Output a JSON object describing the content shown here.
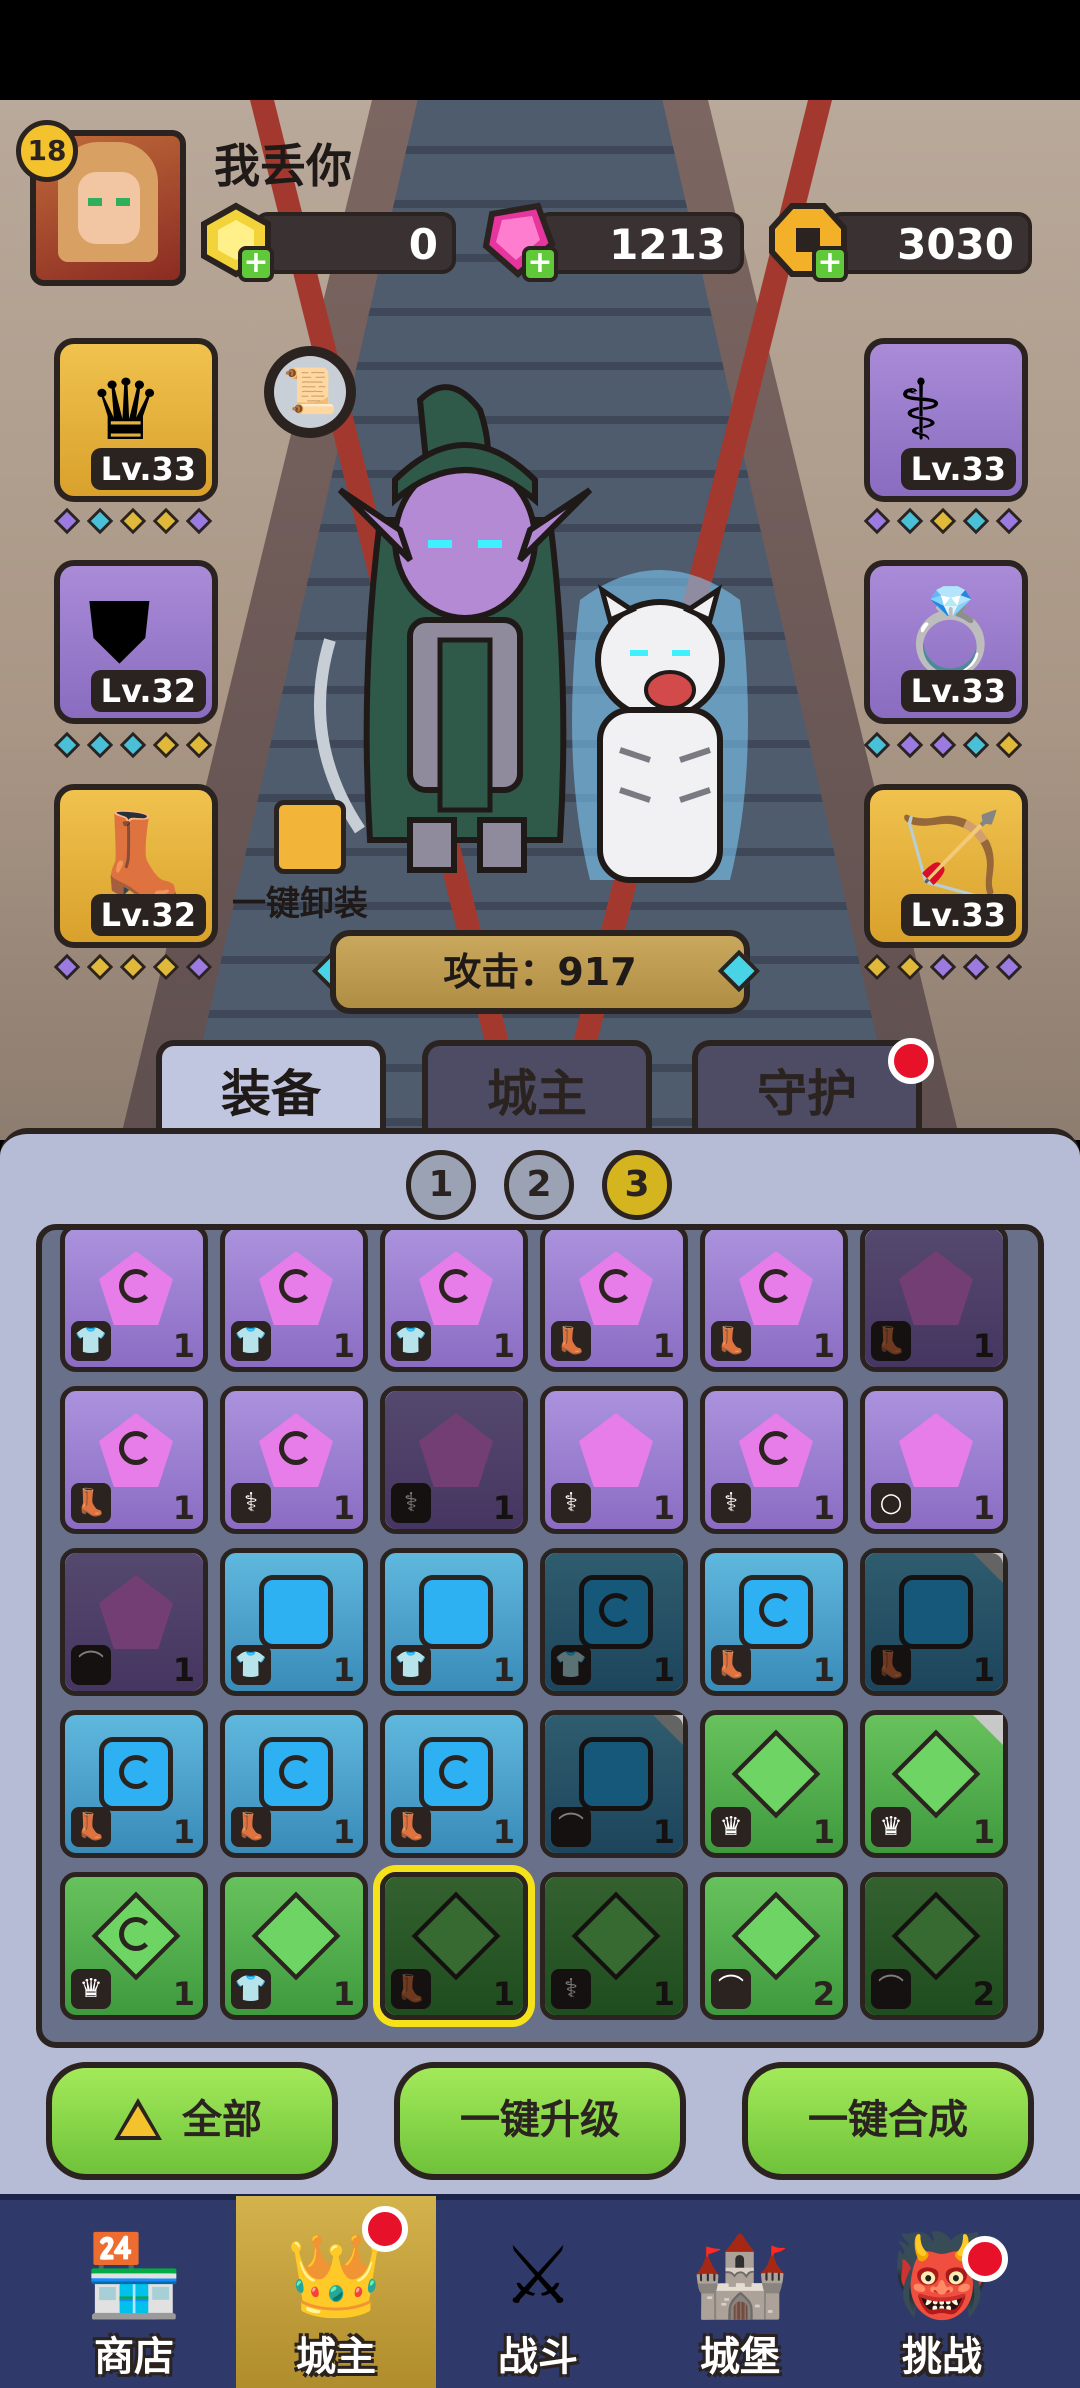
{
  "player": {
    "level": "18",
    "name": "我丢你"
  },
  "currencies": [
    {
      "name": "gold-ingot",
      "value": "0",
      "color": "#f2d43a"
    },
    {
      "name": "pink-gem",
      "value": "1213",
      "color": "#e6359c"
    },
    {
      "name": "coin",
      "value": "3030",
      "color": "#f3b12a"
    }
  ],
  "equipment_left": [
    {
      "name": "crown",
      "level": "Lv.33",
      "icon": "crown-icon",
      "gems": [
        "#9b7be0",
        "#49c0d8",
        "#e0b93a",
        "#e0b93a",
        "#9b7be0"
      ]
    },
    {
      "name": "armor",
      "level": "Lv.32",
      "icon": "armor-icon",
      "gems": [
        "#49c0d8",
        "#49c0d8",
        "#49c0d8",
        "#e0b93a",
        "#e0b93a"
      ]
    },
    {
      "name": "boots",
      "level": "Lv.32",
      "icon": "boot-icon",
      "gems": [
        "#9b7be0",
        "#e0b93a",
        "#e0b93a",
        "#e0b93a",
        "#9b7be0"
      ]
    }
  ],
  "equipment_right": [
    {
      "name": "staff",
      "level": "Lv.33",
      "icon": "staff-icon",
      "gems": [
        "#9b7be0",
        "#49c0d8",
        "#e0b93a",
        "#49c0d8",
        "#9b7be0"
      ]
    },
    {
      "name": "ring",
      "level": "Lv.33",
      "icon": "ring-icon",
      "gems": [
        "#49c0d8",
        "#9b7be0",
        "#9b7be0",
        "#49c0d8",
        "#e0b93a"
      ]
    },
    {
      "name": "bow",
      "level": "Lv.33",
      "icon": "bow-icon",
      "gems": [
        "#e0b93a",
        "#e0b93a",
        "#9b7be0",
        "#9b7be0",
        "#9b7be0"
      ]
    }
  ],
  "unequip_label": "一键卸装",
  "attack_label": "攻击：917",
  "tabs": [
    {
      "label": "装备",
      "active": true
    },
    {
      "label": "城主",
      "active": false
    },
    {
      "label": "守护",
      "active": false,
      "badge": true
    }
  ],
  "pages": [
    "1",
    "2",
    "3"
  ],
  "active_page": "3",
  "inventory": [
    [
      {
        "c": "purple",
        "j": "p",
        "sw": true,
        "t": "shirt",
        "n": "1"
      },
      {
        "c": "purple",
        "j": "p",
        "sw": true,
        "t": "shirt",
        "n": "1"
      },
      {
        "c": "purple",
        "j": "p",
        "sw": true,
        "t": "shirt",
        "n": "1"
      },
      {
        "c": "purple",
        "j": "p",
        "sw": true,
        "t": "boot",
        "n": "1"
      },
      {
        "c": "purple",
        "j": "p",
        "sw": true,
        "t": "boot",
        "n": "1"
      },
      {
        "c": "purple",
        "j": "p",
        "sw": false,
        "t": "boot",
        "n": "1",
        "dim": true
      }
    ],
    [
      {
        "c": "purple",
        "j": "p",
        "sw": true,
        "t": "boot",
        "n": "1"
      },
      {
        "c": "purple",
        "j": "p",
        "sw": true,
        "t": "staff",
        "n": "1"
      },
      {
        "c": "purple",
        "j": "p",
        "sw": false,
        "t": "staff",
        "n": "1",
        "dim": true
      },
      {
        "c": "purple",
        "j": "p",
        "sw": false,
        "t": "staff",
        "n": "1"
      },
      {
        "c": "purple",
        "j": "p",
        "sw": true,
        "t": "staff",
        "n": "1"
      },
      {
        "c": "purple",
        "j": "p",
        "sw": false,
        "t": "ring",
        "n": "1"
      }
    ],
    [
      {
        "c": "purple",
        "j": "p",
        "sw": false,
        "t": "bow",
        "n": "1",
        "dim": true
      },
      {
        "c": "blue",
        "j": "b",
        "sw": false,
        "t": "shirt",
        "n": "1"
      },
      {
        "c": "blue",
        "j": "b",
        "sw": false,
        "t": "shirt",
        "n": "1"
      },
      {
        "c": "blue",
        "j": "b",
        "sw": true,
        "t": "shirt",
        "n": "1",
        "dim": true
      },
      {
        "c": "blue",
        "j": "b",
        "sw": true,
        "t": "boot",
        "n": "1"
      },
      {
        "c": "blue",
        "j": "b",
        "sw": false,
        "t": "boot",
        "n": "1",
        "dim": true,
        "corner": true
      }
    ],
    [
      {
        "c": "blue",
        "j": "b",
        "sw": true,
        "t": "boot",
        "n": "1"
      },
      {
        "c": "blue",
        "j": "b",
        "sw": true,
        "t": "boot",
        "n": "1"
      },
      {
        "c": "blue",
        "j": "b",
        "sw": true,
        "t": "boot",
        "n": "1"
      },
      {
        "c": "blue",
        "j": "b",
        "sw": false,
        "t": "bow",
        "n": "1",
        "dim": true,
        "corner": true
      },
      {
        "c": "green",
        "j": "g",
        "sw": false,
        "t": "crown",
        "n": "1"
      },
      {
        "c": "green",
        "j": "g",
        "sw": false,
        "t": "crown",
        "n": "1",
        "corner": true
      }
    ],
    [
      {
        "c": "green",
        "j": "g",
        "sw": true,
        "t": "crown",
        "n": "1"
      },
      {
        "c": "green",
        "j": "g",
        "sw": false,
        "t": "shirt",
        "n": "1"
      },
      {
        "c": "green",
        "j": "g",
        "sw": false,
        "t": "boot",
        "n": "1",
        "dim": true,
        "sel": true
      },
      {
        "c": "green",
        "j": "g",
        "sw": false,
        "t": "staff",
        "n": "1",
        "dim": true
      },
      {
        "c": "green",
        "j": "g",
        "sw": false,
        "t": "bow",
        "n": "2"
      },
      {
        "c": "green",
        "j": "g",
        "sw": false,
        "t": "bow",
        "n": "2",
        "dim": true
      }
    ]
  ],
  "type_icons": {
    "shirt": "shirt-icon",
    "boot": "boot-icon",
    "staff": "staff-icon",
    "ring": "ring-icon",
    "bow": "bow-icon",
    "crown": "crown-icon"
  },
  "actions": {
    "all": "全部",
    "upgrade": "一键升级",
    "compose": "一键合成"
  },
  "nav": [
    {
      "label": "商店",
      "icon": "shop-icon"
    },
    {
      "label": "城主",
      "icon": "crown-icon",
      "active": true,
      "badge": true
    },
    {
      "label": "战斗",
      "icon": "swords-icon"
    },
    {
      "label": "城堡",
      "icon": "castle-icon"
    },
    {
      "label": "挑战",
      "icon": "demon-icon",
      "badge": true
    }
  ]
}
